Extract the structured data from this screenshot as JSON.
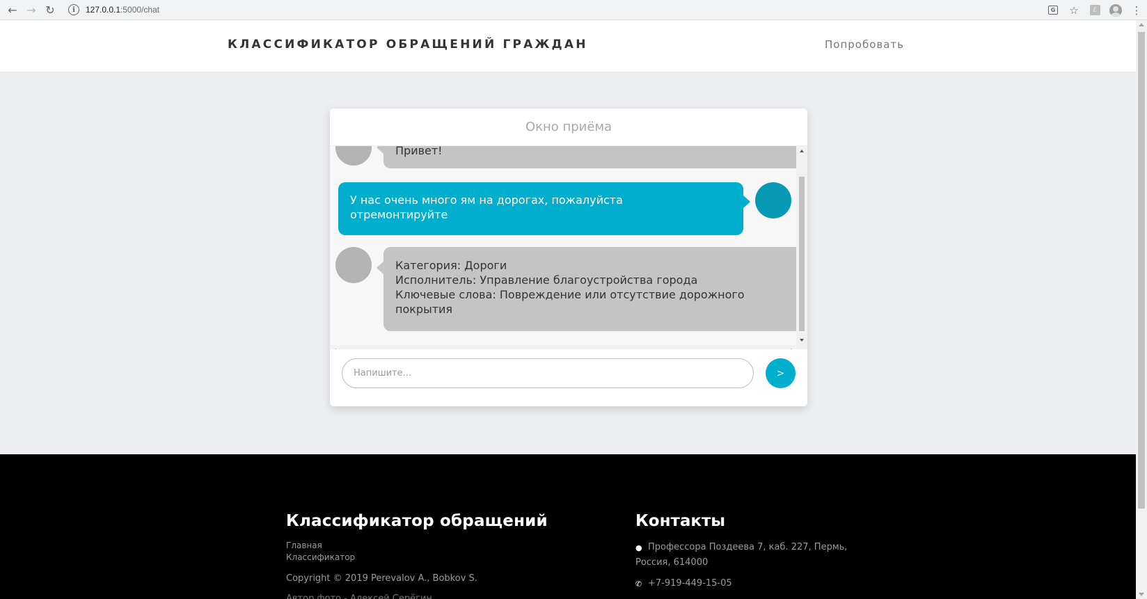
{
  "browser": {
    "url_host": "127.0.0.1",
    "url_path": ":5000/chat",
    "back_icon": "←",
    "forward_icon": "→",
    "reload_icon": "↻",
    "info_icon": "i",
    "translate_icon": "G",
    "bookmark_icon": "☆",
    "extension_icon": "ℰ",
    "menu_icon": "⋮"
  },
  "header": {
    "title": "КЛАССИФИКАТОР ОБРАЩЕНИЙ ГРАЖДАН",
    "nav_try": "Попробовать"
  },
  "chat": {
    "title": "Окно приёма",
    "messages": [
      {
        "sender": "bot",
        "lines": [
          "Привет!"
        ]
      },
      {
        "sender": "user",
        "lines": [
          "У нас очень много ям на дорогах, пожалуйста",
          "отремонтируйте"
        ]
      },
      {
        "sender": "bot",
        "lines": [
          "Категория: Дороги",
          "Исполнитель: Управление благоустройства города",
          "Ключевые слова: Повреждение или отсутствие дорожного",
          "покрытия"
        ]
      }
    ],
    "input_placeholder": "Напишите...",
    "input_value": "",
    "send_label": ">"
  },
  "footer": {
    "brand": "Классификатор обращений",
    "links": [
      "Главная",
      "Классификатор"
    ],
    "copyright": "Copyright © 2019 Perevalov A., Bobkov S.",
    "extra": "Автор фото - Алексей Серёгин",
    "contacts_title": "Контакты",
    "address_line1": "Профессора Поздеева 7, каб. 227, Пермь,",
    "address_line2": "Россия, 614000",
    "phone": "+7-919-449-15-05",
    "globe_icon": "globe-icon",
    "phone_icon": "phone-icon"
  },
  "colors": {
    "accent": "#00afcd",
    "user_avatar": "#0899b5",
    "bot_bubble": "#c4c4c4",
    "page_bg": "#eceef2",
    "footer_bg": "#000000"
  }
}
